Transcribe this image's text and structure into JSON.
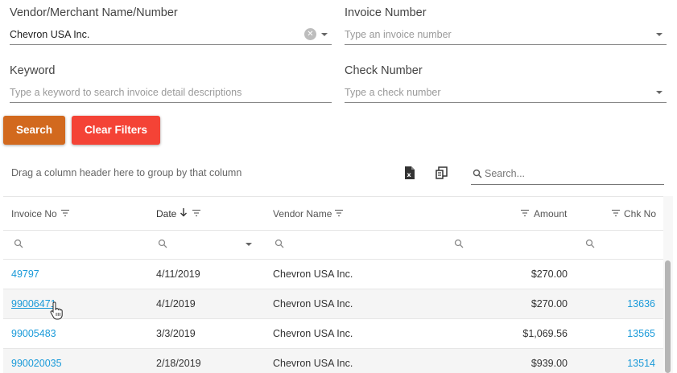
{
  "filters": {
    "vendor": {
      "label": "Vendor/Merchant Name/Number",
      "value": "Chevron USA Inc."
    },
    "invoice_number": {
      "label": "Invoice Number",
      "placeholder": "Type an invoice number"
    },
    "keyword": {
      "label": "Keyword",
      "placeholder": "Type a keyword to search invoice detail descriptions"
    },
    "check_number": {
      "label": "Check Number",
      "placeholder": "Type a check number"
    }
  },
  "buttons": {
    "search": "Search",
    "clear_filters": "Clear Filters"
  },
  "grid": {
    "group_panel_text": "Drag a column header here to group by that column",
    "search_placeholder": "Search...",
    "columns": [
      "Invoice No",
      "Date",
      "Vendor Name",
      "Amount",
      "Chk No"
    ],
    "rows": [
      {
        "invoice": "49797",
        "date": "4/11/2019",
        "vendor": "Chevron USA Inc.",
        "amount": "$270.00",
        "check": ""
      },
      {
        "invoice": "99006471",
        "date": "4/1/2019",
        "vendor": "Chevron USA Inc.",
        "amount": "$270.00",
        "check": "13636"
      },
      {
        "invoice": "99005483",
        "date": "3/3/2019",
        "vendor": "Chevron USA Inc.",
        "amount": "$1,069.56",
        "check": "13565"
      },
      {
        "invoice": "990020035",
        "date": "2/18/2019",
        "vendor": "Chevron USA Inc.",
        "amount": "$939.00",
        "check": "13514"
      }
    ]
  },
  "colors": {
    "search_button": "#d2691e",
    "clear_button": "#f44336",
    "link": "#1a9ad9"
  }
}
